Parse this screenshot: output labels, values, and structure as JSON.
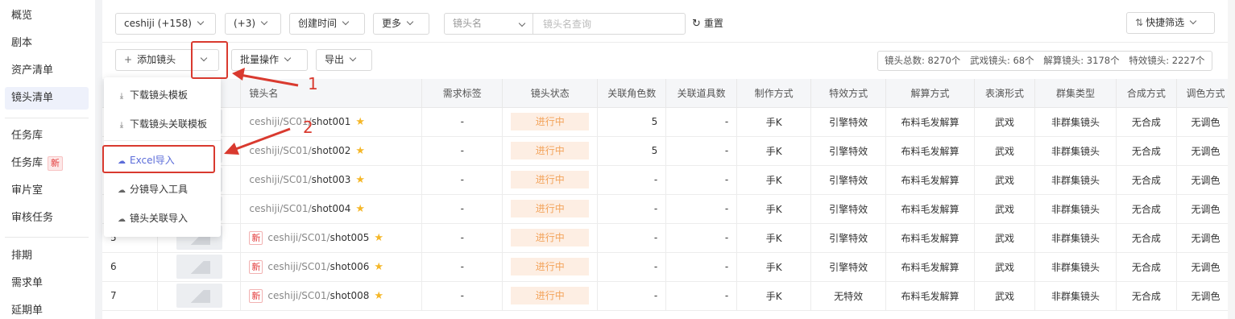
{
  "sidebar": {
    "items": [
      {
        "label": "概览"
      },
      {
        "label": "剧本"
      },
      {
        "label": "资产清单"
      },
      {
        "label": "镜头清单"
      },
      {
        "label": "任务库"
      },
      {
        "label": "任务库",
        "badge": "新"
      },
      {
        "label": "审片室"
      },
      {
        "label": "审核任务"
      },
      {
        "label": "排期"
      },
      {
        "label": "需求单"
      },
      {
        "label": "延期单"
      }
    ]
  },
  "filters": {
    "project": "ceshiji (+158)",
    "extra": "(+3)",
    "created_time": "创建时间",
    "more": "更多",
    "field_select": "镜头名",
    "search_placeholder": "镜头名查询",
    "reset": "重置",
    "quick_filter": "快捷筛选"
  },
  "toolbar": {
    "add_shot": "添加镜头",
    "batch_ops": "批量操作",
    "export": "导出"
  },
  "stats": {
    "total": "镜头总数: 8270个",
    "fight": "武戏镜头: 68个",
    "solve": "解算镜头: 3178个",
    "vfx": "特效镜头: 2227个"
  },
  "dropdown": {
    "items": [
      {
        "label": "下载镜头模板",
        "icon": "download-icon"
      },
      {
        "label": "下载镜头关联模板",
        "icon": "download-icon"
      },
      {
        "label": "Excel导入",
        "icon": "cloud-upload-icon"
      },
      {
        "label": "分镜导入工具",
        "icon": "cloud-upload-icon"
      },
      {
        "label": "镜头关联导入",
        "icon": "cloud-upload-icon"
      }
    ]
  },
  "annotations": {
    "n1": "1",
    "n2": "2"
  },
  "table": {
    "headers": [
      "镜头名",
      "需求标签",
      "镜头状态",
      "关联角色数",
      "关联道具数",
      "制作方式",
      "特效方式",
      "解算方式",
      "表演形式",
      "群集类型",
      "合成方式",
      "调色方式"
    ],
    "rows": [
      {
        "index": "",
        "new": "",
        "prefix": "ceshiji/SC01/",
        "shot": "shot001",
        "tag": "-",
        "status": "进行中",
        "roles": "5",
        "props": "-",
        "make": "手K",
        "fx": "引擎特效",
        "solve": "布料毛发解算",
        "perform": "武戏",
        "crowd": "非群集镜头",
        "comp": "无合成",
        "color": "无调色"
      },
      {
        "index": "",
        "new": "",
        "prefix": "ceshiji/SC01/",
        "shot": "shot002",
        "tag": "-",
        "status": "进行中",
        "roles": "5",
        "props": "-",
        "make": "手K",
        "fx": "引擎特效",
        "solve": "布料毛发解算",
        "perform": "武戏",
        "crowd": "非群集镜头",
        "comp": "无合成",
        "color": "无调色"
      },
      {
        "index": "",
        "new": "",
        "prefix": "ceshiji/SC01/",
        "shot": "shot003",
        "tag": "-",
        "status": "进行中",
        "roles": "-",
        "props": "-",
        "make": "手K",
        "fx": "引擎特效",
        "solve": "布料毛发解算",
        "perform": "武戏",
        "crowd": "非群集镜头",
        "comp": "无合成",
        "color": "无调色"
      },
      {
        "index": "",
        "new": "",
        "prefix": "ceshiji/SC01/",
        "shot": "shot004",
        "tag": "-",
        "status": "进行中",
        "roles": "-",
        "props": "-",
        "make": "手K",
        "fx": "引擎特效",
        "solve": "布料毛发解算",
        "perform": "武戏",
        "crowd": "非群集镜头",
        "comp": "无合成",
        "color": "无调色"
      },
      {
        "index": "5",
        "new": "新",
        "prefix": "ceshiji/SC01/",
        "shot": "shot005",
        "tag": "-",
        "status": "进行中",
        "roles": "-",
        "props": "-",
        "make": "手K",
        "fx": "引擎特效",
        "solve": "布料毛发解算",
        "perform": "武戏",
        "crowd": "非群集镜头",
        "comp": "无合成",
        "color": "无调色"
      },
      {
        "index": "6",
        "new": "新",
        "prefix": "ceshiji/SC01/",
        "shot": "shot006",
        "tag": "-",
        "status": "进行中",
        "roles": "-",
        "props": "-",
        "make": "手K",
        "fx": "引擎特效",
        "solve": "布料毛发解算",
        "perform": "武戏",
        "crowd": "非群集镜头",
        "comp": "无合成",
        "color": "无调色"
      },
      {
        "index": "7",
        "new": "新",
        "prefix": "ceshiji/SC01/",
        "shot": "shot008",
        "tag": "-",
        "status": "进行中",
        "roles": "-",
        "props": "-",
        "make": "手K",
        "fx": "无特效",
        "solve": "布料毛发解算",
        "perform": "武戏",
        "crowd": "非群集镜头",
        "comp": "无合成",
        "color": "无调色"
      }
    ]
  },
  "colors": {
    "accent": "#5b6cd9",
    "annotation": "#d93a2f",
    "status_bg": "#fdeee3",
    "status_text": "#f3a35a"
  }
}
